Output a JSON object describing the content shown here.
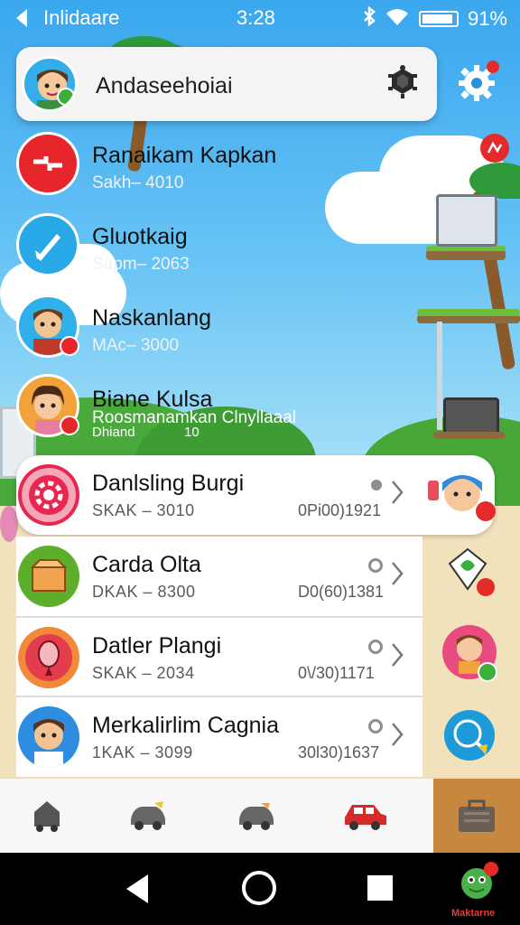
{
  "status_bar": {
    "app_title": "Inlidaare",
    "time": "3:28",
    "battery_percent": "91%",
    "battery_level": 0.91
  },
  "search": {
    "title": "Andaseehoiai"
  },
  "transparent_items": [
    {
      "name": "Ranaikam Kapkan",
      "sub": "Sakh– 4010",
      "icon": "gear-icon",
      "color": "#e7262b"
    },
    {
      "name": "Gluotkaig",
      "sub": "Sapm– 2063",
      "icon": "rocket-icon",
      "color": "#28a8e6"
    },
    {
      "name": "Naskanlang",
      "sub": "MAc– 3000",
      "icon": "boy-avatar-icon",
      "color": "#2fb0e8"
    },
    {
      "name": "Biane Kulsa",
      "sub": "Roosmanamkan  Clnyllaaal",
      "sub2": "Dhiand",
      "sub2_right": "10",
      "icon": "girl-avatar-icon",
      "color": "#f2a23a"
    }
  ],
  "cards": [
    {
      "name": "Danlsling Burgi",
      "code": "SKAK –   3010",
      "num": "0Pi00)1921",
      "marker": "dot",
      "icon": "gear-badge-icon",
      "color": "#e8264f"
    },
    {
      "name": "Carda Olta",
      "code": "DKAK –   8300",
      "num": "D0(60)1381",
      "marker": "ring",
      "icon": "box-icon",
      "color": "#5cae2b"
    },
    {
      "name": "Datler Plangi",
      "code": "SKAK –   2034",
      "num": "0\\/30)1171",
      "marker": "ring",
      "icon": "balloon-icon",
      "color": "#e23c4d"
    },
    {
      "name": "Merkalirlim Cagnia",
      "code": "1KAK –   3099",
      "num": "30l30)1637",
      "marker": "ring",
      "icon": "boy-avatar-icon",
      "color": "#2e8de0"
    }
  ],
  "bottom_nav": [
    {
      "icon": "home-icon"
    },
    {
      "icon": "car-icon"
    },
    {
      "icon": "car-icon"
    },
    {
      "icon": "red-car-icon"
    },
    {
      "icon": "toolbox-icon",
      "selected": true
    }
  ],
  "system_bar": {
    "mascot_label": "Maktarne"
  }
}
